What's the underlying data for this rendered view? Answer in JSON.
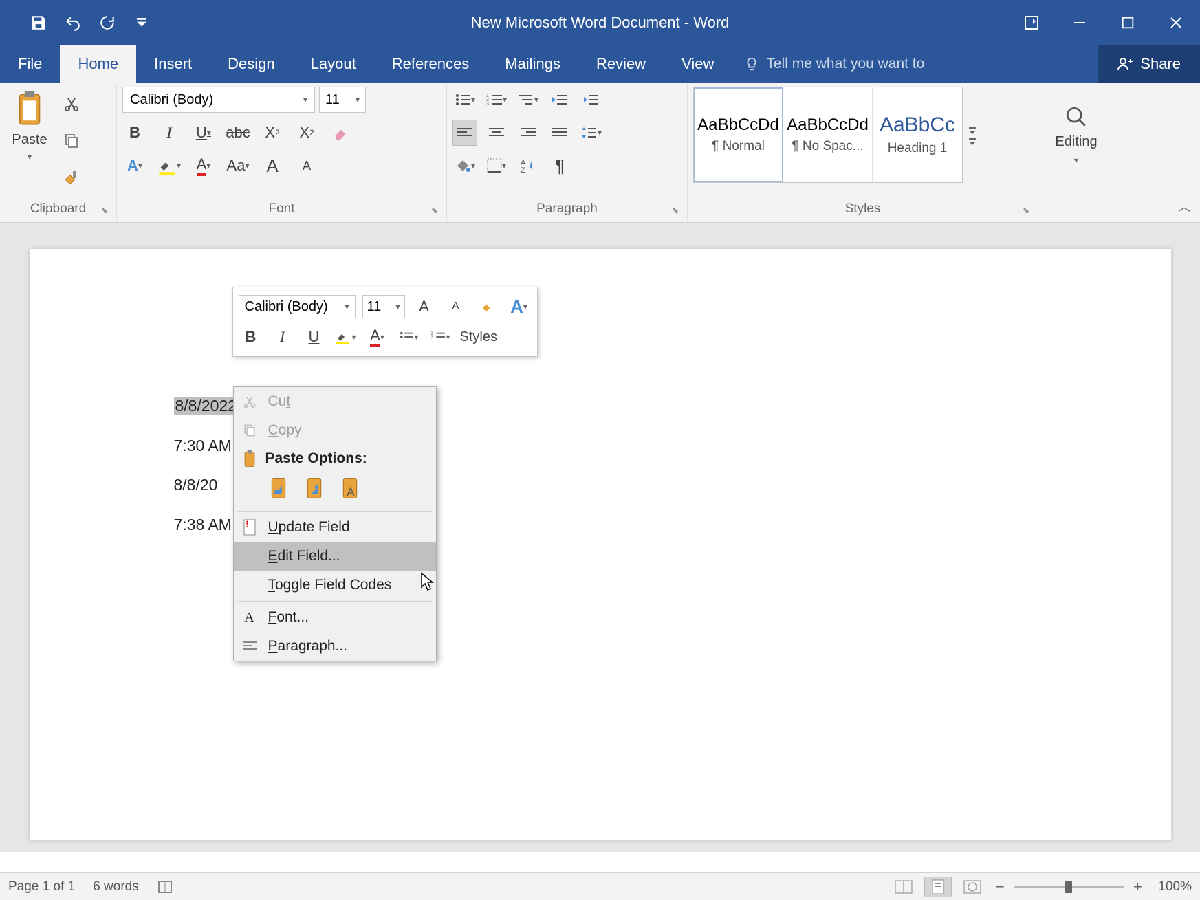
{
  "title": "New Microsoft Word Document - Word",
  "tabs": {
    "file": "File",
    "home": "Home",
    "insert": "Insert",
    "design": "Design",
    "layout": "Layout",
    "references": "References",
    "mailings": "Mailings",
    "review": "Review",
    "view": "View",
    "tellme_placeholder": "Tell me what you want to",
    "share": "Share"
  },
  "ribbon": {
    "clipboard": {
      "label": "Clipboard",
      "paste": "Paste"
    },
    "font": {
      "label": "Font",
      "name": "Calibri (Body)",
      "size": "11"
    },
    "paragraph": {
      "label": "Paragraph"
    },
    "styles": {
      "label": "Styles",
      "items": [
        {
          "sample": "AaBbCcDd",
          "name": "¶ Normal"
        },
        {
          "sample": "AaBbCcDd",
          "name": "¶ No Spac..."
        },
        {
          "sample": "AaBbCc",
          "name": "Heading 1"
        }
      ]
    },
    "editing": {
      "label": "Editing"
    }
  },
  "document": {
    "lines": [
      "8/8/2022",
      "7:30 AM",
      "8/8/20",
      "7:38 AM"
    ],
    "selected_field": "8/8/2022"
  },
  "mini_toolbar": {
    "font_name": "Calibri (Body)",
    "font_size": "11",
    "styles": "Styles"
  },
  "context_menu": {
    "cut": "Cut",
    "copy": "Copy",
    "paste_header": "Paste Options:",
    "update_field": "Update Field",
    "edit_field": "Edit Field...",
    "toggle_codes": "Toggle Field Codes",
    "font": "Font...",
    "paragraph": "Paragraph..."
  },
  "statusbar": {
    "page": "Page 1 of 1",
    "words": "6 words",
    "zoom": "100%"
  }
}
